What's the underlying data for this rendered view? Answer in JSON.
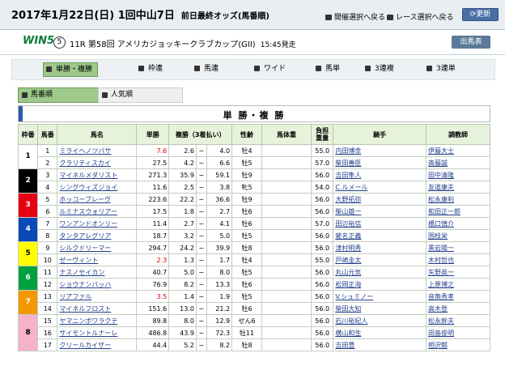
{
  "header": {
    "title": "2017年1月22日(日) 1回中山7日",
    "subtitle": "前日最終オッズ(馬番順)",
    "nav_meeting": "開催選択へ戻る",
    "nav_race": "レース選択へ戻る",
    "update": "更新"
  },
  "race": {
    "logo": "WIN5",
    "win5_number": "5",
    "info": "11R 第58回 アメリカジョッキークラブカップ(GII)",
    "start": "15:45発走",
    "entries_button": "出馬表"
  },
  "tabs": [
    "単勝・複勝",
    "枠連",
    "馬連",
    "ワイド",
    "馬単",
    "3連複",
    "3連単"
  ],
  "sort": {
    "by_number": "馬番順",
    "by_popularity": "人気順"
  },
  "section_title": "単 勝・複 勝",
  "columns": {
    "waku": "枠番",
    "umaban": "馬番",
    "name": "馬名",
    "win": "単勝",
    "place": "複勝（3着払い）",
    "sex_age": "性齢",
    "weight": "馬体重",
    "burden_line1": "負担",
    "burden_line2": "重量",
    "jockey": "騎手",
    "trainer": "調教師"
  },
  "dash": "−",
  "colors": {
    "waku1": "#ffffff",
    "waku2": "#000000",
    "waku3": "#e60012",
    "waku4": "#0a49b8",
    "waku5": "#ffff00",
    "waku6": "#00a040",
    "waku7": "#f39800",
    "waku8": "#f5b2c8",
    "favorite_odds": "#e00000"
  },
  "horses": [
    {
      "waku": 1,
      "num": 1,
      "name": "ミライヘノツバサ",
      "win": "7.6",
      "pmin": "2.6",
      "pmax": "4.0",
      "sex": "牡4",
      "wt": "",
      "burden": "55.0",
      "jockey": "内田博幸",
      "trainer": "伊藤大士",
      "red": true
    },
    {
      "waku": 1,
      "num": 2,
      "name": "クラリティスカイ",
      "win": "27.5",
      "pmin": "4.2",
      "pmax": "6.6",
      "sex": "牡5",
      "wt": "",
      "burden": "57.0",
      "jockey": "柴田善臣",
      "trainer": "斎藤誠",
      "red": false
    },
    {
      "waku": 2,
      "num": 3,
      "name": "マイネルメダリスト",
      "win": "271.3",
      "pmin": "35.9",
      "pmax": "59.1",
      "sex": "牡9",
      "wt": "",
      "burden": "56.0",
      "jockey": "吉田隼人",
      "trainer": "田中清隆",
      "red": false
    },
    {
      "waku": 2,
      "num": 4,
      "name": "シングウィズジョイ",
      "win": "11.6",
      "pmin": "2.5",
      "pmax": "3.8",
      "sex": "牝5",
      "wt": "",
      "burden": "54.0",
      "jockey": "C.ルメール",
      "trainer": "友道康夫",
      "red": false
    },
    {
      "waku": 3,
      "num": 5,
      "name": "ホッコーブレーヴ",
      "win": "223.6",
      "pmin": "22.2",
      "pmax": "36.6",
      "sex": "牡9",
      "wt": "",
      "burden": "56.0",
      "jockey": "大野拓弥",
      "trainer": "松永康利",
      "red": false
    },
    {
      "waku": 3,
      "num": 6,
      "name": "ルミナスウォリアー",
      "win": "17.5",
      "pmin": "1.8",
      "pmax": "2.7",
      "sex": "牡6",
      "wt": "",
      "burden": "56.0",
      "jockey": "柴山雄一",
      "trainer": "和田正一郎",
      "red": false
    },
    {
      "waku": 4,
      "num": 7,
      "name": "ワンアンドオンリー",
      "win": "11.4",
      "pmin": "2.7",
      "pmax": "4.1",
      "sex": "牡6",
      "wt": "",
      "burden": "57.0",
      "jockey": "田辺裕信",
      "trainer": "橋口慎介",
      "red": false
    },
    {
      "waku": 4,
      "num": 8,
      "name": "タンタアレグリア",
      "win": "18.7",
      "pmin": "3.2",
      "pmax": "5.0",
      "sex": "牡5",
      "wt": "",
      "burden": "56.0",
      "jockey": "蛯名正義",
      "trainer": "国枝栄",
      "red": false
    },
    {
      "waku": 5,
      "num": 9,
      "name": "シルクドリーマー",
      "win": "294.7",
      "pmin": "24.2",
      "pmax": "39.9",
      "sex": "牡8",
      "wt": "",
      "burden": "56.0",
      "jockey": "津村明秀",
      "trainer": "黒岩陽一",
      "red": false
    },
    {
      "waku": 5,
      "num": 10,
      "name": "ゼーヴィント",
      "win": "2.3",
      "pmin": "1.3",
      "pmax": "1.7",
      "sex": "牡4",
      "wt": "",
      "burden": "55.0",
      "jockey": "戸崎圭太",
      "trainer": "木村哲也",
      "red": true
    },
    {
      "waku": 6,
      "num": 11,
      "name": "ナスノセイカン",
      "win": "40.7",
      "pmin": "5.0",
      "pmax": "8.0",
      "sex": "牡5",
      "wt": "",
      "burden": "56.0",
      "jockey": "丸山元気",
      "trainer": "矢野英一",
      "red": false
    },
    {
      "waku": 6,
      "num": 12,
      "name": "ショウナンバッハ",
      "win": "76.9",
      "pmin": "8.2",
      "pmax": "13.3",
      "sex": "牡6",
      "wt": "",
      "burden": "56.0",
      "jockey": "松岡正海",
      "trainer": "上原博之",
      "red": false
    },
    {
      "waku": 7,
      "num": 13,
      "name": "リアファル",
      "win": "3.5",
      "pmin": "1.4",
      "pmax": "1.9",
      "sex": "牡5",
      "wt": "",
      "burden": "56.0",
      "jockey": "V.シュミノー",
      "trainer": "音無秀孝",
      "red": true
    },
    {
      "waku": 7,
      "num": 14,
      "name": "マイネルフロスト",
      "win": "151.6",
      "pmin": "13.0",
      "pmax": "21.2",
      "sex": "牡6",
      "wt": "",
      "burden": "56.0",
      "jockey": "柴田大知",
      "trainer": "高木登",
      "red": false
    },
    {
      "waku": 8,
      "num": 15,
      "name": "ヤマニンボワラクテ",
      "win": "89.8",
      "pmin": "8.0",
      "pmax": "12.9",
      "sex": "せん6",
      "wt": "",
      "burden": "56.0",
      "jockey": "石川裕紀人",
      "trainer": "松永幹夫",
      "red": false
    },
    {
      "waku": 8,
      "num": 16,
      "name": "サイモントルナーレ",
      "win": "486.8",
      "pmin": "43.9",
      "pmax": "72.3",
      "sex": "牡11",
      "wt": "",
      "burden": "56.0",
      "jockey": "横山和生",
      "trainer": "田島俊明",
      "red": false
    },
    {
      "waku": 8,
      "num": 17,
      "name": "クリールカイザー",
      "win": "44.4",
      "pmin": "5.2",
      "pmax": "8.2",
      "sex": "牡8",
      "wt": "",
      "burden": "56.0",
      "jockey": "吉田豊",
      "trainer": "相沢郁",
      "red": false
    }
  ]
}
